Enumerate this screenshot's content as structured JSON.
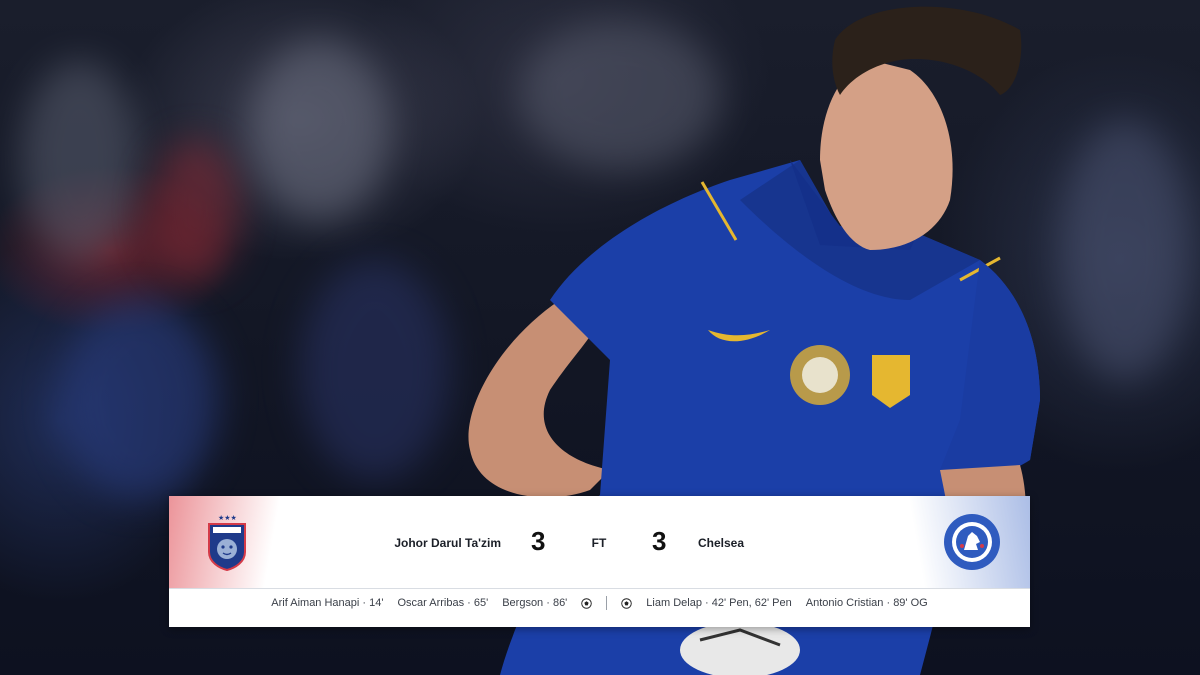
{
  "match": {
    "home_team": "Johor Darul Ta'zim",
    "away_team": "Chelsea",
    "home_score": "3",
    "away_score": "3",
    "status": "FT"
  },
  "home_scorers": [
    "Arif Aiman Hanapi · 14'",
    "Oscar Arribas · 65'",
    "Bergson · 86'"
  ],
  "away_scorers": [
    "Liam Delap · 42' Pen, 62' Pen",
    "Antonio Cristian · 89' OG"
  ],
  "icons": {
    "home_crest": "jdt-tiger-crest",
    "away_crest": "chelsea-lion-crest",
    "goal": "football-icon"
  },
  "colors": {
    "home_accent": "#d43a48",
    "away_accent": "#2f5bbf",
    "kit_blue": "#1b3fa8",
    "kit_gold": "#e5b730"
  }
}
